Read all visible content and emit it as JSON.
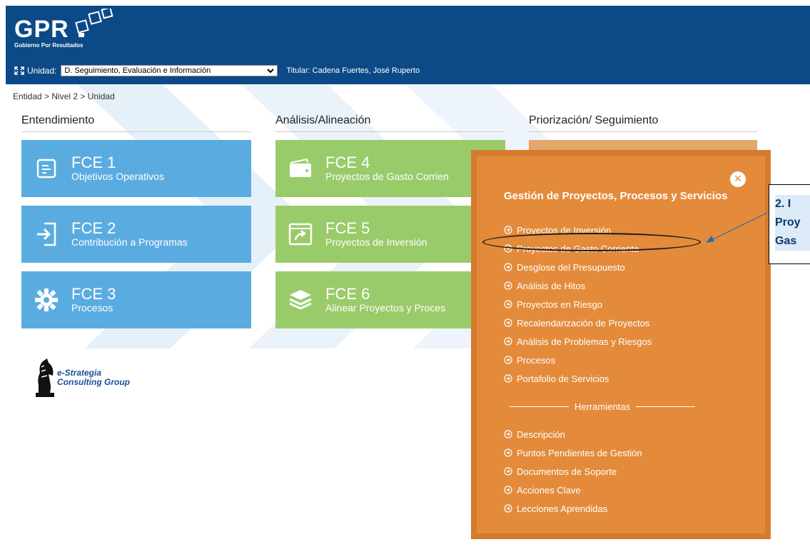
{
  "header": {
    "logo_text": "GPR",
    "logo_sub": "Gobierno Por Resultados",
    "unit_label": "Unidad:",
    "unit_value": "D. Seguimiento, Evaluación e Información",
    "titular": "Titular: Cadena Fuertes, José Ruperto",
    "bg_color": "#0b4a86"
  },
  "breadcrumb": "Entidad >  Nivel 2 >  Unidad",
  "sections": {
    "entendimiento": "Entendimiento",
    "analisis": "Análisis/Alineación",
    "priorizacion": "Priorización/ Seguimiento"
  },
  "tiles": {
    "fce1": {
      "title": "FCE 1",
      "subtitle": "Objetivos Operativos",
      "icon": "document-icon"
    },
    "fce2": {
      "title": "FCE 2",
      "subtitle": "Contribución a Programas",
      "icon": "login-icon"
    },
    "fce3": {
      "title": "FCE 3",
      "subtitle": "Procesos",
      "icon": "gear-icon"
    },
    "fce4": {
      "title": "FCE 4",
      "subtitle": "Proyectos de Gasto Corrien",
      "icon": "wallet-icon"
    },
    "fce5": {
      "title": "FCE 5",
      "subtitle": "Proyectos de Inversión",
      "icon": "share-icon"
    },
    "fce6": {
      "title": "FCE 6",
      "subtitle": "Alinear Proyectos y Proces",
      "icon": "layers-icon"
    }
  },
  "logo_estrategia": {
    "line1": "e-Strategia",
    "line2": "Consulting Group"
  },
  "popup": {
    "title": "Gestión de Proyectos, Procesos y Servicios",
    "close": "✕",
    "items": [
      "Proyectos de Inversión",
      "Proyectos de Gasto Corriente",
      "Desglose del Presupuesto",
      "Análisis de Hitos",
      "Proyectos en Riesgo",
      "Recalendarización de Proyectos",
      "Análisis de Problemas y Riesgos",
      "Procesos",
      "Portafolio de Servicios"
    ],
    "tools_heading": "Herramientas",
    "tools": [
      "Descripción",
      "Puntos Pendientes de Gestión",
      "Documentos de Soporte",
      "Acciones Clave",
      "Lecciones Aprendidas"
    ]
  },
  "callout": {
    "line1": "2.  I",
    "line2": "Proy",
    "line3": "Gas"
  },
  "colors": {
    "blue": "#5aace0",
    "green": "#9acb6b",
    "orange": "#e38b3b"
  }
}
